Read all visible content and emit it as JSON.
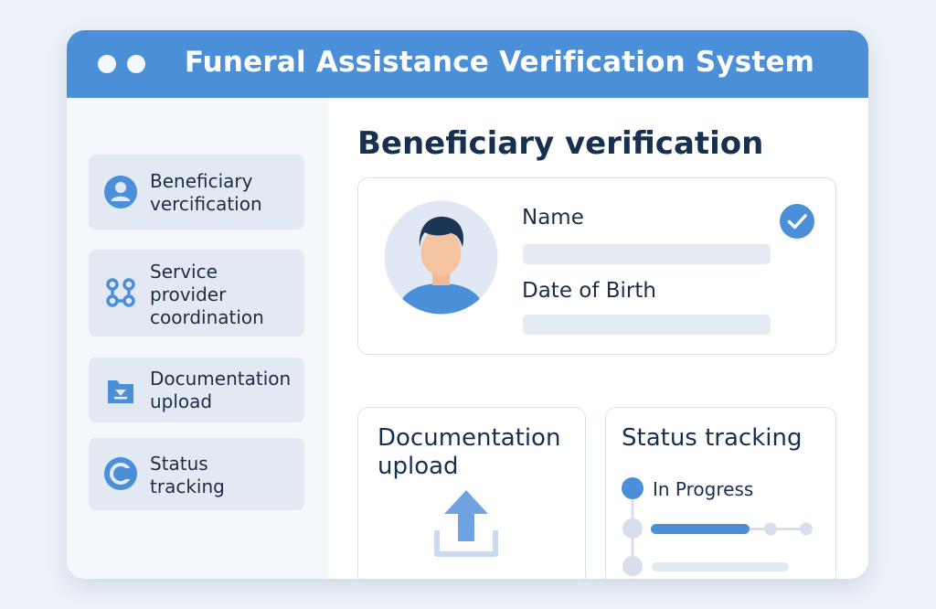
{
  "window": {
    "title": "Funeral Assistance Verification System"
  },
  "sidebar": {
    "items": [
      {
        "label": "Beneficiary\nvercification",
        "icon": "user-icon"
      },
      {
        "label": "Service\nprovider\ncoordination",
        "icon": "network-icon"
      },
      {
        "label": "Documentation\nupload",
        "icon": "folder-download-icon"
      },
      {
        "label": "Status\ntracking",
        "icon": "status-ring-icon"
      }
    ]
  },
  "main": {
    "heading": "Beneficiary verification",
    "profile": {
      "name_label": "Name",
      "dob_label": "Date of Birth",
      "verified": true
    },
    "upload": {
      "title": "Documentation\nupload"
    },
    "status": {
      "title": "Status tracking",
      "current_step": "In Progress"
    }
  },
  "colors": {
    "accent": "#4b8fd8",
    "sidebar_item": "#e2e9f3",
    "text_dark": "#17304f"
  }
}
